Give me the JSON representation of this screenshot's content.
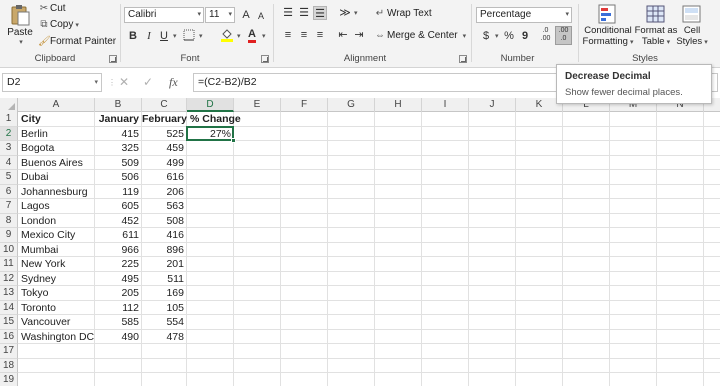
{
  "ribbon": {
    "clipboard": {
      "paste_label": "Paste",
      "cut_label": "Cut",
      "copy_label": "Copy",
      "format_painter_label": "Format Painter",
      "group_label": "Clipboard"
    },
    "font": {
      "font_name": "Calibri",
      "font_size": "11",
      "bold": "B",
      "italic": "I",
      "underline": "U",
      "font_color_letter": "A",
      "grow_letter": "A",
      "shrink_letter": "A",
      "group_label": "Font"
    },
    "alignment": {
      "wrap_text_label": "Wrap Text",
      "merge_center_label": "Merge & Center",
      "group_label": "Alignment"
    },
    "number": {
      "format_value": "Percentage",
      "currency_symbol": "$",
      "percent_symbol": "%",
      "comma_symbol": "9",
      "group_label": "Number"
    },
    "styles": {
      "conditional_line1": "Conditional",
      "conditional_line2": "Formatting",
      "format_table_line1": "Format as",
      "format_table_line2": "Table",
      "cell_styles_line1": "Cell",
      "cell_styles_line2": "Styles",
      "group_label": "Styles"
    }
  },
  "tooltip": {
    "title": "Decrease Decimal",
    "description": "Show fewer decimal places."
  },
  "formula_bar": {
    "name_box": "D2",
    "formula": "=(C2-B2)/B2"
  },
  "sheet": {
    "columns": [
      "A",
      "B",
      "C",
      "D",
      "E",
      "F",
      "G",
      "H",
      "I",
      "J",
      "K",
      "L",
      "M",
      "N"
    ],
    "row_numbers": [
      "1",
      "2",
      "3",
      "4",
      "5",
      "6",
      "7",
      "8",
      "9",
      "10",
      "11",
      "12",
      "13",
      "14",
      "15",
      "16",
      "17",
      "18",
      "19"
    ],
    "header_row": {
      "city": "City",
      "january": "January",
      "february": "February",
      "change": "% Change"
    },
    "rows": [
      {
        "city": "Berlin",
        "jan": "415",
        "feb": "525",
        "change": "27%"
      },
      {
        "city": "Bogota",
        "jan": "325",
        "feb": "459",
        "change": ""
      },
      {
        "city": "Buenos Aires",
        "jan": "509",
        "feb": "499",
        "change": ""
      },
      {
        "city": "Dubai",
        "jan": "506",
        "feb": "616",
        "change": ""
      },
      {
        "city": "Johannesburg",
        "jan": "119",
        "feb": "206",
        "change": ""
      },
      {
        "city": "Lagos",
        "jan": "605",
        "feb": "563",
        "change": ""
      },
      {
        "city": "London",
        "jan": "452",
        "feb": "508",
        "change": ""
      },
      {
        "city": "Mexico City",
        "jan": "611",
        "feb": "416",
        "change": ""
      },
      {
        "city": "Mumbai",
        "jan": "966",
        "feb": "896",
        "change": ""
      },
      {
        "city": "New York",
        "jan": "225",
        "feb": "201",
        "change": ""
      },
      {
        "city": "Sydney",
        "jan": "495",
        "feb": "511",
        "change": ""
      },
      {
        "city": "Tokyo",
        "jan": "205",
        "feb": "169",
        "change": ""
      },
      {
        "city": "Toronto",
        "jan": "112",
        "feb": "105",
        "change": ""
      },
      {
        "city": "Vancouver",
        "jan": "585",
        "feb": "554",
        "change": ""
      },
      {
        "city": "Washington DC",
        "jan": "490",
        "feb": "478",
        "change": ""
      }
    ],
    "selected_cell": "D2",
    "accent_color": "#217346"
  }
}
